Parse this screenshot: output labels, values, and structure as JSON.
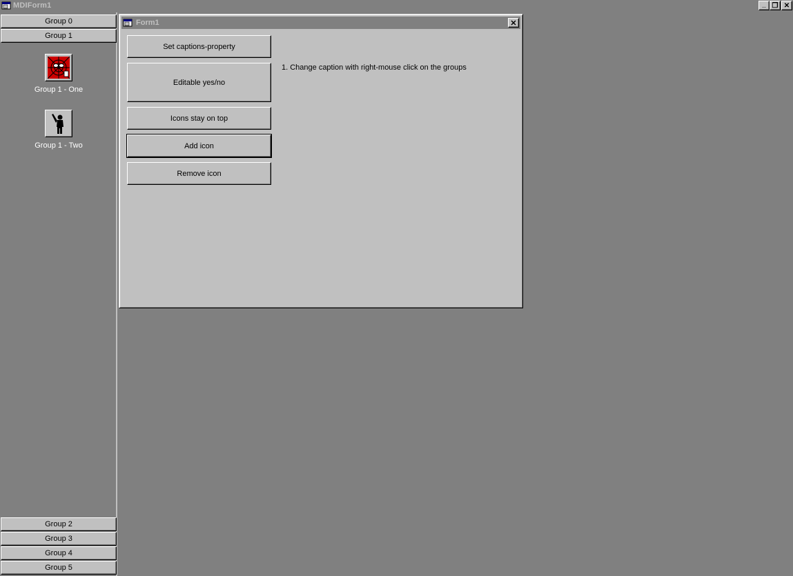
{
  "window": {
    "title": "MDIForm1",
    "minimize_glyph": "_",
    "restore_glyph": "❐",
    "close_glyph": "✕"
  },
  "groups": {
    "top": [
      {
        "label": "Group 0"
      },
      {
        "label": "Group 1"
      }
    ],
    "bottom": [
      {
        "label": "Group 2"
      },
      {
        "label": "Group 3"
      },
      {
        "label": "Group 4"
      },
      {
        "label": "Group 5"
      }
    ],
    "icons": [
      {
        "label": "Group 1 - One",
        "icon": "spiderman-icon"
      },
      {
        "label": "Group 1 - Two",
        "icon": "person-waving-icon"
      }
    ]
  },
  "form": {
    "title": "Form1",
    "close_glyph": "✕",
    "buttons": [
      {
        "label": "Set captions-property"
      },
      {
        "label": "Editable yes/no"
      },
      {
        "label": "Icons stay on top"
      },
      {
        "label": "Add icon"
      },
      {
        "label": "Remove icon"
      }
    ],
    "info": "1. Change caption with right-mouse click on the groups"
  },
  "colors": {
    "desktop": "#808080",
    "face": "#c0c0c0",
    "label_text": "#ffffff",
    "icon_red": "#cc0000"
  }
}
